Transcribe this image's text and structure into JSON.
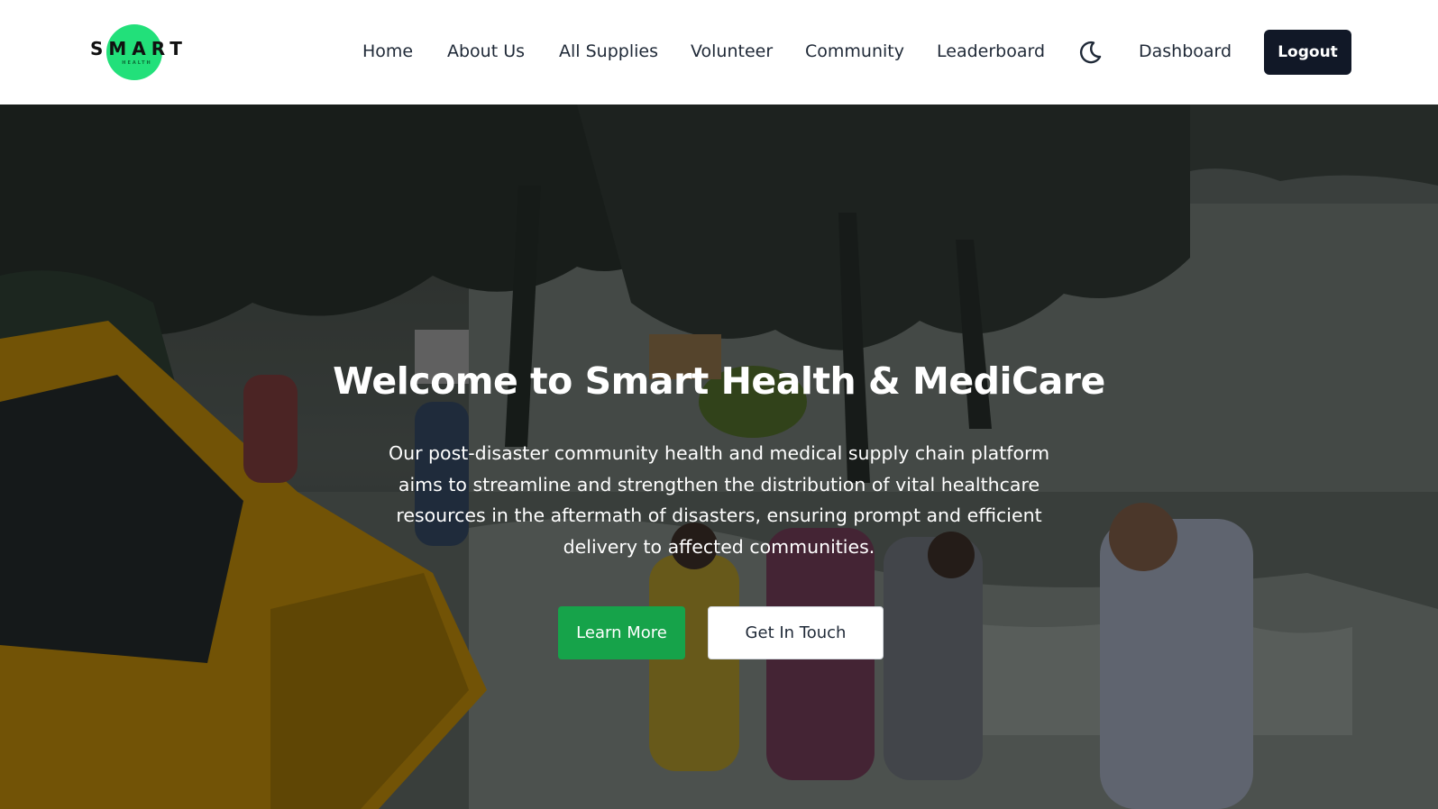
{
  "brand": {
    "logo_word": "SMART",
    "logo_sub": "HEALTH",
    "accent_color": "#22e07a"
  },
  "nav": {
    "items": [
      {
        "label": "Home"
      },
      {
        "label": "About Us"
      },
      {
        "label": "All Supplies"
      },
      {
        "label": "Volunteer"
      },
      {
        "label": "Community"
      },
      {
        "label": "Leaderboard"
      }
    ],
    "theme_toggle_icon": "moon-icon",
    "dashboard_label": "Dashboard",
    "logout_label": "Logout"
  },
  "hero": {
    "title": "Welcome to Smart Health & MediCare",
    "description": "Our post-disaster community health and medical supply chain platform aims to streamline and strengthen the distribution of vital healthcare resources in the aftermath of disasters, ensuring prompt and efficient delivery to affected communities.",
    "primary_button": "Learn More",
    "secondary_button": "Get In Touch",
    "primary_color": "#16a34a"
  }
}
